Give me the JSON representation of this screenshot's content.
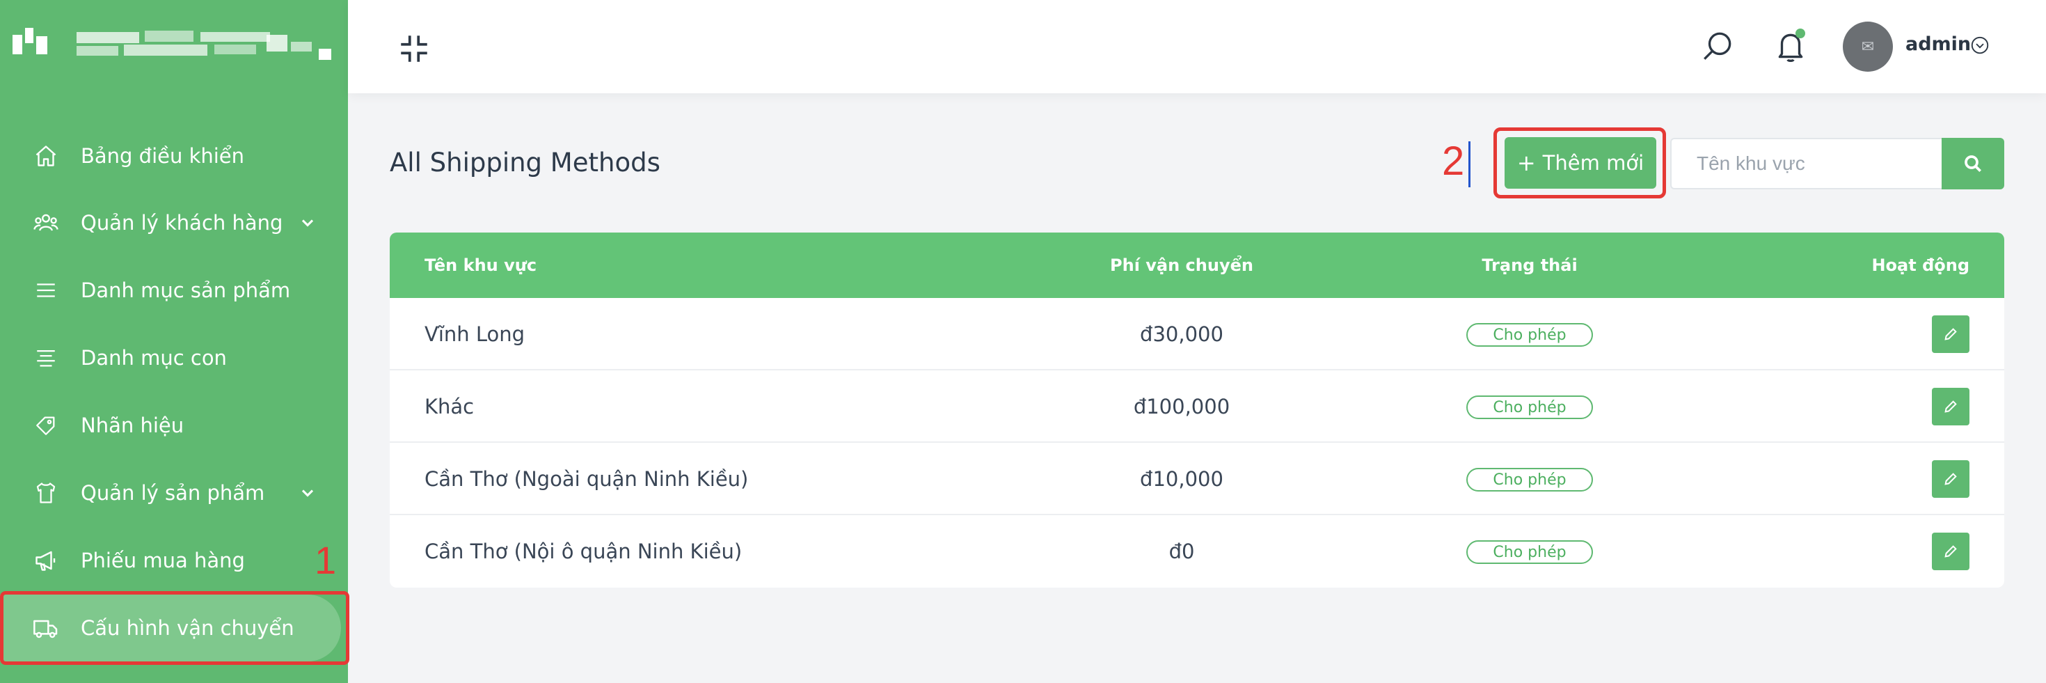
{
  "sidebar": {
    "items": [
      {
        "label": "Bảng điều khiển",
        "icon": "home-icon",
        "has_submenu": false,
        "active": false
      },
      {
        "label": "Quản lý khách hàng",
        "icon": "users-icon",
        "has_submenu": true,
        "active": false
      },
      {
        "label": "Danh mục sản phẩm",
        "icon": "list-icon",
        "has_submenu": false,
        "active": false
      },
      {
        "label": "Danh mục con",
        "icon": "align-center-icon",
        "has_submenu": false,
        "active": false
      },
      {
        "label": "Nhãn hiệu",
        "icon": "tag-icon",
        "has_submenu": false,
        "active": false
      },
      {
        "label": "Quản lý sản phẩm",
        "icon": "shirt-icon",
        "has_submenu": true,
        "active": false
      },
      {
        "label": "Phiếu mua hàng",
        "icon": "megaphone-icon",
        "has_submenu": false,
        "active": false
      },
      {
        "label": "Cấu hình vận chuyển",
        "icon": "truck-icon",
        "has_submenu": false,
        "active": true
      }
    ]
  },
  "header": {
    "username": "admin"
  },
  "annotations": {
    "step1": "1",
    "step2": "2",
    "color": "#e53935"
  },
  "page": {
    "title": "All Shipping Methods",
    "add_button_label": "Thêm mới",
    "search_placeholder": "Tên khu vực"
  },
  "table": {
    "columns": [
      "Tên khu vực",
      "Phí vận chuyển",
      "Trạng thái",
      "Hoạt động"
    ],
    "rows": [
      {
        "name": "Vĩnh Long",
        "fee": "đ30,000",
        "status": "Cho phép"
      },
      {
        "name": "Khác",
        "fee": "đ100,000",
        "status": "Cho phép"
      },
      {
        "name": "Cần Thơ (Ngoài quận Ninh Kiều)",
        "fee": "đ10,000",
        "status": "Cho phép"
      },
      {
        "name": "Cần Thơ (Nội ô quận Ninh Kiều)",
        "fee": "đ0",
        "status": "Cho phép"
      }
    ]
  },
  "colors": {
    "brand_green": "#5fb971",
    "sidebar_active": "#7fc88d",
    "table_header": "#63c477"
  }
}
